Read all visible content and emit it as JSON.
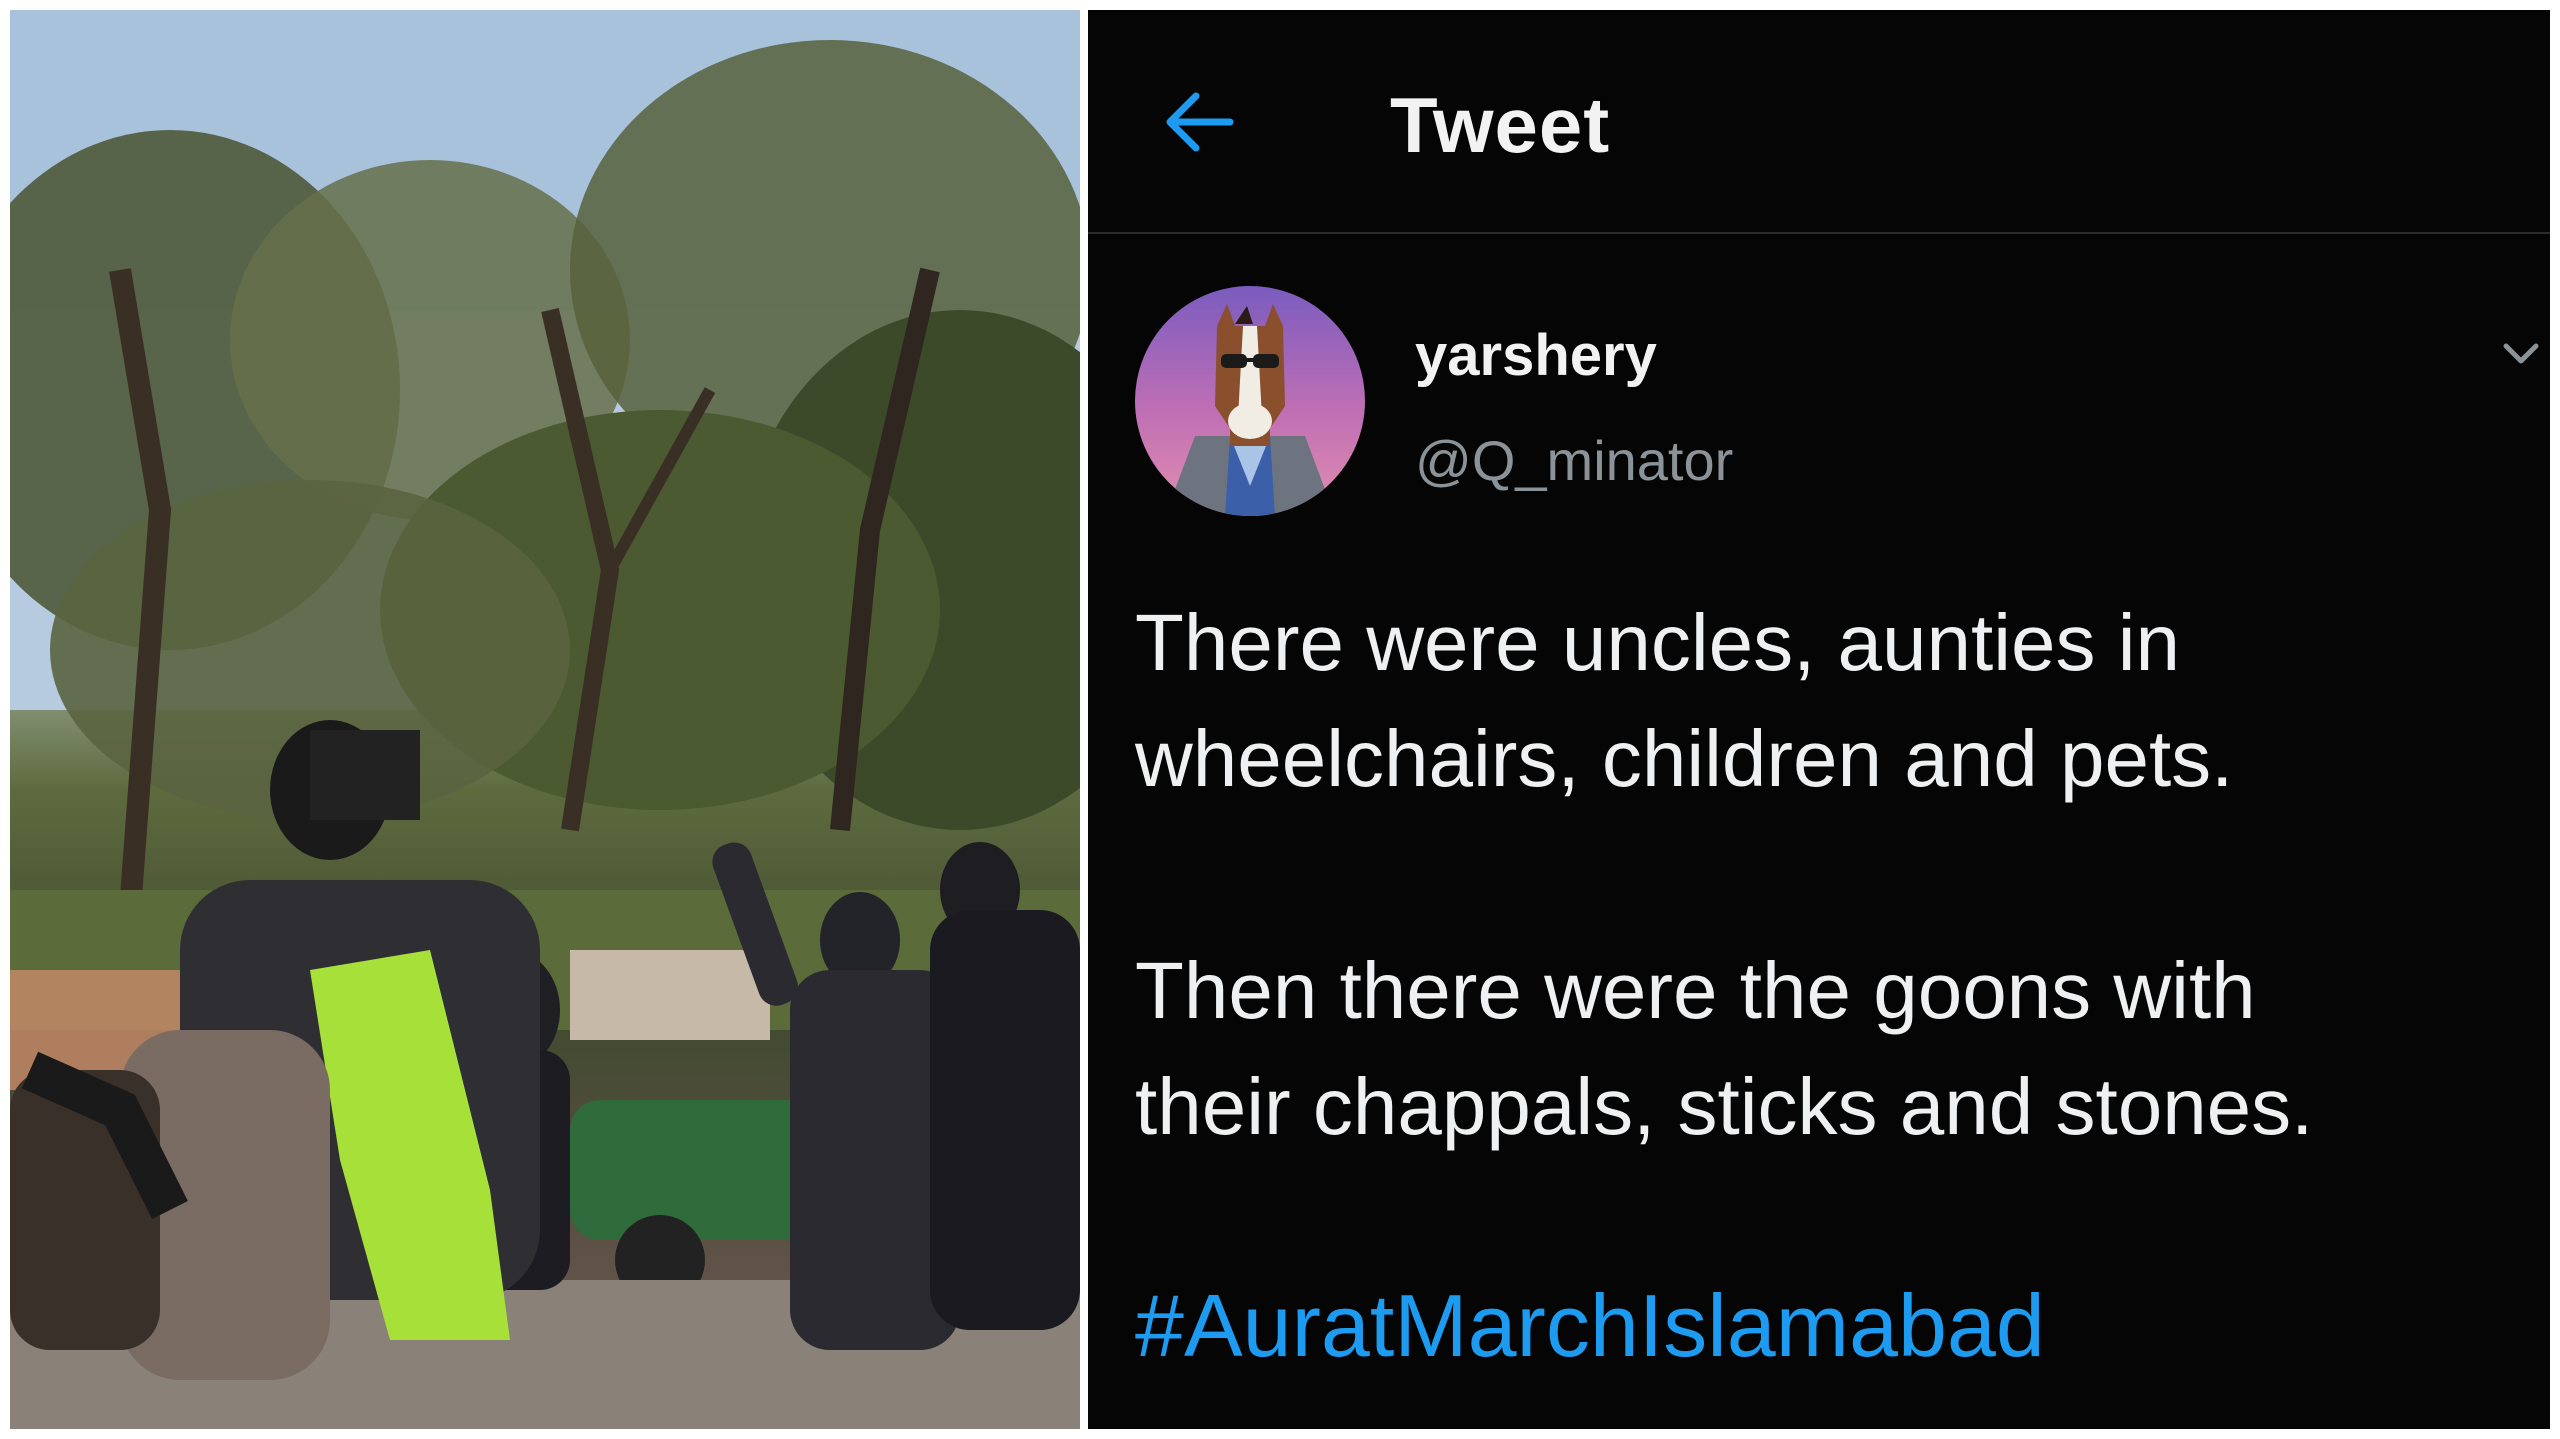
{
  "photo": {
    "description_icon": "protest-crowd-photo"
  },
  "header": {
    "title": "Tweet",
    "back_icon": "arrow-left-icon"
  },
  "author": {
    "display_name": "yarshery",
    "handle": "@Q_minator",
    "avatar_icon": "bojack-horse-avatar"
  },
  "tweet": {
    "line1": "There were uncles, aunties in",
    "line2": "wheelchairs, children and pets.",
    "line3": "Then there were the goons with",
    "line4": "their chappals, sticks and stones.",
    "hashtag": "#AuratMarchIslamabad"
  },
  "colors": {
    "background": "#050505",
    "accent": "#1d9bf0",
    "text": "#eef0f1",
    "muted": "#8b9399"
  }
}
